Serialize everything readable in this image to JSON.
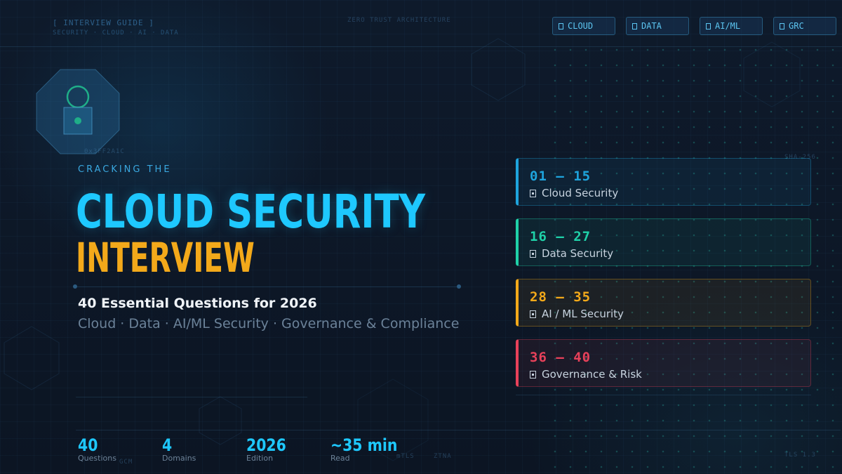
{
  "header": {
    "guide_title": "[ INTERVIEW GUIDE ]",
    "guide_subtitle": "SECURITY · CLOUD · AI · DATA",
    "center_label": "ZERO TRUST ARCHITECTURE"
  },
  "tags": [
    {
      "label": "CLOUD"
    },
    {
      "label": "DATA"
    },
    {
      "label": "AI/ML"
    },
    {
      "label": "GRC"
    }
  ],
  "hero": {
    "eyebrow": "CRACKING THE",
    "title_line1": "CLOUD SECURITY",
    "title_line2": "INTERVIEW",
    "subheading": "40 Essential Questions for 2026",
    "topics": "Cloud · Data · AI/ML Security · Governance & Compliance"
  },
  "sections": [
    {
      "range": "01 — 15",
      "label": "Cloud Security",
      "color": "#1ea4dd"
    },
    {
      "range": "16 — 27",
      "label": "Data Security",
      "color": "#1fd1a8"
    },
    {
      "range": "28 — 35",
      "label": "AI / ML Security",
      "color": "#f3a91a"
    },
    {
      "range": "36 — 40",
      "label": "Governance & Risk",
      "color": "#e8415a"
    }
  ],
  "stats": [
    {
      "value": "40",
      "label": "Questions"
    },
    {
      "value": "4",
      "label": "Domains"
    },
    {
      "value": "2026",
      "label": "Edition"
    },
    {
      "value": "~35 min",
      "label": "Read"
    }
  ],
  "micro": {
    "hash": "0x3FF2A1C",
    "sha": "SHA-256",
    "gcm": "GCM",
    "mtls": "mTLS",
    "ztna": "ZTNA",
    "tls": "TLS 1.3"
  },
  "colors": {
    "accent_cyan": "#1ec8ff",
    "accent_orange": "#f3a91a",
    "background": "#0d1726"
  }
}
